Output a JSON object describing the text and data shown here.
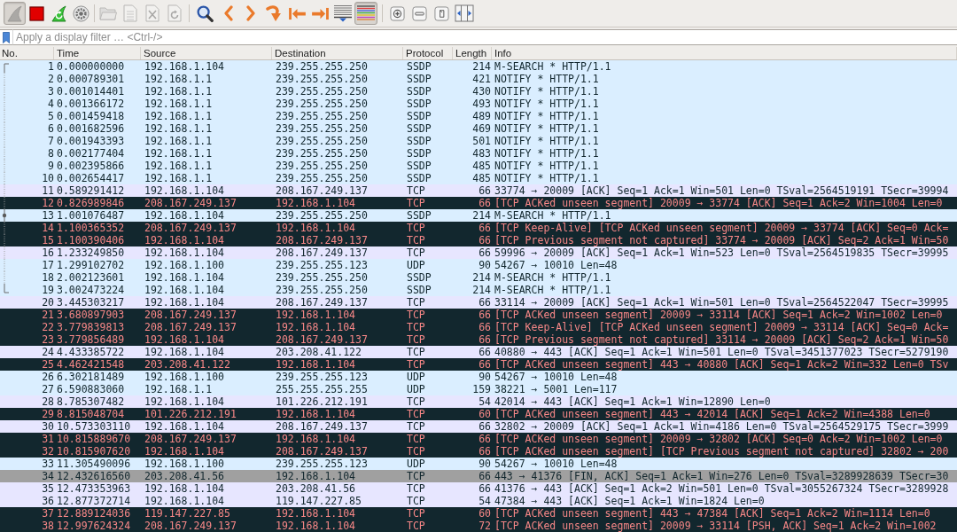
{
  "toolbar": {
    "groups": [
      {
        "buttons": [
          {
            "pressed": true,
            "disabled": true
          },
          {
            "pressed": false,
            "disabled": false
          },
          {
            "pressed": false,
            "disabled": false
          },
          {
            "pressed": false,
            "disabled": false
          }
        ]
      },
      {
        "buttons": [
          {
            "pressed": false,
            "disabled": true
          },
          {
            "pressed": false,
            "disabled": true
          },
          {
            "pressed": false,
            "disabled": true
          },
          {
            "pressed": false,
            "disabled": true
          }
        ]
      },
      {
        "buttons": [
          {
            "pressed": false,
            "disabled": false
          },
          {
            "pressed": false,
            "disabled": false
          },
          {
            "pressed": false,
            "disabled": false
          },
          {
            "pressed": false,
            "disabled": false
          },
          {
            "pressed": false,
            "disabled": false
          },
          {
            "pressed": false,
            "disabled": false
          },
          {
            "pressed": false,
            "disabled": false
          },
          {
            "pressed": true,
            "disabled": false
          }
        ]
      },
      {
        "buttons": [
          {
            "pressed": false,
            "disabled": false
          },
          {
            "pressed": false,
            "disabled": false
          },
          {
            "pressed": false,
            "disabled": false
          },
          {
            "pressed": false,
            "disabled": false
          }
        ]
      }
    ]
  },
  "display_filter": {
    "placeholder": "Apply a display filter … <Ctrl-/>"
  },
  "packet_list": {
    "columns": [
      "No.",
      "Time",
      "Source",
      "Destination",
      "Protocol",
      "Length",
      "Info"
    ],
    "rows": [
      {
        "no": "1",
        "time": "0.000000000",
        "source": "192.168.1.104",
        "destination": "239.255.255.250",
        "protocol": "SSDP",
        "length": "214",
        "info": "M-SEARCH * HTTP/1.1",
        "kind": "udp",
        "conversation": true,
        "related": false
      },
      {
        "no": "2",
        "time": "0.000789301",
        "source": "192.168.1.1",
        "destination": "239.255.255.250",
        "protocol": "SSDP",
        "length": "421",
        "info": "NOTIFY * HTTP/1.1",
        "kind": "udp",
        "conversation": true,
        "related": false
      },
      {
        "no": "3",
        "time": "0.001014401",
        "source": "192.168.1.1",
        "destination": "239.255.255.250",
        "protocol": "SSDP",
        "length": "430",
        "info": "NOTIFY * HTTP/1.1",
        "kind": "udp",
        "conversation": true,
        "related": false
      },
      {
        "no": "4",
        "time": "0.001366172",
        "source": "192.168.1.1",
        "destination": "239.255.255.250",
        "protocol": "SSDP",
        "length": "493",
        "info": "NOTIFY * HTTP/1.1",
        "kind": "udp",
        "conversation": true,
        "related": false
      },
      {
        "no": "5",
        "time": "0.001459418",
        "source": "192.168.1.1",
        "destination": "239.255.255.250",
        "protocol": "SSDP",
        "length": "489",
        "info": "NOTIFY * HTTP/1.1",
        "kind": "udp",
        "conversation": true,
        "related": false
      },
      {
        "no": "6",
        "time": "0.001682596",
        "source": "192.168.1.1",
        "destination": "239.255.255.250",
        "protocol": "SSDP",
        "length": "469",
        "info": "NOTIFY * HTTP/1.1",
        "kind": "udp",
        "conversation": true,
        "related": false
      },
      {
        "no": "7",
        "time": "0.001943393",
        "source": "192.168.1.1",
        "destination": "239.255.255.250",
        "protocol": "SSDP",
        "length": "501",
        "info": "NOTIFY * HTTP/1.1",
        "kind": "udp",
        "conversation": true,
        "related": false
      },
      {
        "no": "8",
        "time": "0.002177404",
        "source": "192.168.1.1",
        "destination": "239.255.255.250",
        "protocol": "SSDP",
        "length": "483",
        "info": "NOTIFY * HTTP/1.1",
        "kind": "udp",
        "conversation": true,
        "related": false
      },
      {
        "no": "9",
        "time": "0.002395866",
        "source": "192.168.1.1",
        "destination": "239.255.255.250",
        "protocol": "SSDP",
        "length": "485",
        "info": "NOTIFY * HTTP/1.1",
        "kind": "udp",
        "conversation": true,
        "related": false
      },
      {
        "no": "10",
        "time": "0.002654417",
        "source": "192.168.1.1",
        "destination": "239.255.255.250",
        "protocol": "SSDP",
        "length": "485",
        "info": "NOTIFY * HTTP/1.1",
        "kind": "udp",
        "conversation": true,
        "related": false
      },
      {
        "no": "11",
        "time": "0.589291412",
        "source": "192.168.1.104",
        "destination": "208.167.249.137",
        "protocol": "TCP",
        "length": "66",
        "info": "33774 → 20009 [ACK] Seq=1 Ack=1 Win=501 Len=0 TSval=2564519191 TSecr=39994",
        "kind": "tcp",
        "conversation": true,
        "related": false
      },
      {
        "no": "12",
        "time": "0.826989846",
        "source": "208.167.249.137",
        "destination": "192.168.1.104",
        "protocol": "TCP",
        "length": "66",
        "info": "[TCP ACKed unseen segment] 20009 → 33774 [ACK] Seq=1 Ack=2 Win=1004 Len=0",
        "kind": "badtcp",
        "conversation": true,
        "related": false
      },
      {
        "no": "13",
        "time": "1.001076487",
        "source": "192.168.1.104",
        "destination": "239.255.255.250",
        "protocol": "SSDP",
        "length": "214",
        "info": "M-SEARCH * HTTP/1.1",
        "kind": "udp",
        "conversation": true,
        "related": true
      },
      {
        "no": "14",
        "time": "1.100365352",
        "source": "208.167.249.137",
        "destination": "192.168.1.104",
        "protocol": "TCP",
        "length": "66",
        "info": "[TCP Keep-Alive] [TCP ACKed unseen segment] 20009 → 33774 [ACK] Seq=0 Ack=",
        "kind": "badtcp",
        "conversation": true,
        "related": false
      },
      {
        "no": "15",
        "time": "1.100390406",
        "source": "192.168.1.104",
        "destination": "208.167.249.137",
        "protocol": "TCP",
        "length": "66",
        "info": "[TCP Previous segment not captured] 33774 → 20009 [ACK] Seq=2 Ack=1 Win=50",
        "kind": "badtcp",
        "conversation": true,
        "related": false
      },
      {
        "no": "16",
        "time": "1.233249850",
        "source": "192.168.1.104",
        "destination": "208.167.249.137",
        "protocol": "TCP",
        "length": "66",
        "info": "59996 → 20009 [ACK] Seq=1 Ack=1 Win=523 Len=0 TSval=2564519835 TSecr=39995",
        "kind": "tcp",
        "conversation": true,
        "related": false
      },
      {
        "no": "17",
        "time": "1.299102702",
        "source": "192.168.1.100",
        "destination": "239.255.255.123",
        "protocol": "UDP",
        "length": "90",
        "info": "54267 → 10010 Len=48",
        "kind": "udp",
        "conversation": true,
        "related": false
      },
      {
        "no": "18",
        "time": "2.002123601",
        "source": "192.168.1.104",
        "destination": "239.255.255.250",
        "protocol": "SSDP",
        "length": "214",
        "info": "M-SEARCH * HTTP/1.1",
        "kind": "udp",
        "conversation": true,
        "related": false
      },
      {
        "no": "19",
        "time": "3.002473224",
        "source": "192.168.1.104",
        "destination": "239.255.255.250",
        "protocol": "SSDP",
        "length": "214",
        "info": "M-SEARCH * HTTP/1.1",
        "kind": "udp",
        "conversation": true,
        "related": false
      },
      {
        "no": "20",
        "time": "3.445303217",
        "source": "192.168.1.104",
        "destination": "208.167.249.137",
        "protocol": "TCP",
        "length": "66",
        "info": "33114 → 20009 [ACK] Seq=1 Ack=1 Win=501 Len=0 TSval=2564522047 TSecr=39995",
        "kind": "tcp",
        "conversation": false,
        "related": false
      },
      {
        "no": "21",
        "time": "3.680897903",
        "source": "208.167.249.137",
        "destination": "192.168.1.104",
        "protocol": "TCP",
        "length": "66",
        "info": "[TCP ACKed unseen segment] 20009 → 33114 [ACK] Seq=1 Ack=2 Win=1002 Len=0",
        "kind": "badtcp",
        "conversation": false,
        "related": false
      },
      {
        "no": "22",
        "time": "3.779839813",
        "source": "208.167.249.137",
        "destination": "192.168.1.104",
        "protocol": "TCP",
        "length": "66",
        "info": "[TCP Keep-Alive] [TCP ACKed unseen segment] 20009 → 33114 [ACK] Seq=0 Ack=",
        "kind": "badtcp",
        "conversation": false,
        "related": false
      },
      {
        "no": "23",
        "time": "3.779856489",
        "source": "192.168.1.104",
        "destination": "208.167.249.137",
        "protocol": "TCP",
        "length": "66",
        "info": "[TCP Previous segment not captured] 33114 → 20009 [ACK] Seq=2 Ack=1 Win=50",
        "kind": "badtcp",
        "conversation": false,
        "related": false
      },
      {
        "no": "24",
        "time": "4.433385722",
        "source": "192.168.1.104",
        "destination": "203.208.41.122",
        "protocol": "TCP",
        "length": "66",
        "info": "40880 → 443 [ACK] Seq=1 Ack=1 Win=501 Len=0 TSval=3451377023 TSecr=5279190",
        "kind": "tcp",
        "conversation": false,
        "related": false
      },
      {
        "no": "25",
        "time": "4.462421548",
        "source": "203.208.41.122",
        "destination": "192.168.1.104",
        "protocol": "TCP",
        "length": "66",
        "info": "[TCP ACKed unseen segment] 443 → 40880 [ACK] Seq=1 Ack=2 Win=332 Len=0 TSv",
        "kind": "badtcp",
        "conversation": false,
        "related": false
      },
      {
        "no": "26",
        "time": "6.302181489",
        "source": "192.168.1.100",
        "destination": "239.255.255.123",
        "protocol": "UDP",
        "length": "90",
        "info": "54267 → 10010 Len=48",
        "kind": "udp",
        "conversation": false,
        "related": false
      },
      {
        "no": "27",
        "time": "6.590883060",
        "source": "192.168.1.1",
        "destination": "255.255.255.255",
        "protocol": "UDP",
        "length": "159",
        "info": "38221 → 5001 Len=117",
        "kind": "udp",
        "conversation": false,
        "related": false
      },
      {
        "no": "28",
        "time": "8.785307482",
        "source": "192.168.1.104",
        "destination": "101.226.212.191",
        "protocol": "TCP",
        "length": "54",
        "info": "42014 → 443 [ACK] Seq=1 Ack=1 Win=12890 Len=0",
        "kind": "tcp",
        "conversation": false,
        "related": false
      },
      {
        "no": "29",
        "time": "8.815048704",
        "source": "101.226.212.191",
        "destination": "192.168.1.104",
        "protocol": "TCP",
        "length": "60",
        "info": "[TCP ACKed unseen segment] 443 → 42014 [ACK] Seq=1 Ack=2 Win=4388 Len=0",
        "kind": "badtcp",
        "conversation": false,
        "related": false
      },
      {
        "no": "30",
        "time": "10.573303110",
        "source": "192.168.1.104",
        "destination": "208.167.249.137",
        "protocol": "TCP",
        "length": "66",
        "info": "32802 → 20009 [ACK] Seq=1 Ack=1 Win=4186 Len=0 TSval=2564529175 TSecr=3999",
        "kind": "tcp",
        "conversation": false,
        "related": false
      },
      {
        "no": "31",
        "time": "10.815889670",
        "source": "208.167.249.137",
        "destination": "192.168.1.104",
        "protocol": "TCP",
        "length": "66",
        "info": "[TCP ACKed unseen segment] 20009 → 32802 [ACK] Seq=0 Ack=2 Win=1002 Len=0",
        "kind": "badtcp",
        "conversation": false,
        "related": false
      },
      {
        "no": "32",
        "time": "10.815907620",
        "source": "192.168.1.104",
        "destination": "208.167.249.137",
        "protocol": "TCP",
        "length": "66",
        "info": "[TCP ACKed unseen segment] [TCP Previous segment not captured] 32802 → 200",
        "kind": "badtcp",
        "conversation": false,
        "related": false
      },
      {
        "no": "33",
        "time": "11.305490096",
        "source": "192.168.1.100",
        "destination": "239.255.255.123",
        "protocol": "UDP",
        "length": "90",
        "info": "54267 → 10010 Len=48",
        "kind": "udp",
        "conversation": false,
        "related": false
      },
      {
        "no": "34",
        "time": "12.432616560",
        "source": "203.208.41.56",
        "destination": "192.168.1.104",
        "protocol": "TCP",
        "length": "66",
        "info": "443 → 41376 [FIN, ACK] Seq=1 Ack=1 Win=276 Len=0 TSval=3289928639 TSecr=30",
        "kind": "synfin",
        "conversation": false,
        "related": false
      },
      {
        "no": "35",
        "time": "12.473353963",
        "source": "192.168.1.104",
        "destination": "203.208.41.56",
        "protocol": "TCP",
        "length": "66",
        "info": "41376 → 443 [ACK] Seq=1 Ack=2 Win=501 Len=0 TSval=3055267324 TSecr=3289928",
        "kind": "tcp",
        "conversation": false,
        "related": false
      },
      {
        "no": "36",
        "time": "12.877372714",
        "source": "192.168.1.104",
        "destination": "119.147.227.85",
        "protocol": "TCP",
        "length": "54",
        "info": "47384 → 443 [ACK] Seq=1 Ack=1 Win=1824 Len=0",
        "kind": "tcp",
        "conversation": false,
        "related": false
      },
      {
        "no": "37",
        "time": "12.889124036",
        "source": "119.147.227.85",
        "destination": "192.168.1.104",
        "protocol": "TCP",
        "length": "60",
        "info": "[TCP ACKed unseen segment] 443 → 47384 [ACK] Seq=1 Ack=2 Win=1114 Len=0",
        "kind": "badtcp",
        "conversation": false,
        "related": false
      },
      {
        "no": "38",
        "time": "12.997624324",
        "source": "208.167.249.137",
        "destination": "192.168.1.104",
        "protocol": "TCP",
        "length": "72",
        "info": "[TCP ACKed unseen segment] 20009 → 33114 [PSH, ACK] Seq=1 Ack=2 Win=1002",
        "kind": "badtcp",
        "conversation": false,
        "related": false
      }
    ]
  }
}
